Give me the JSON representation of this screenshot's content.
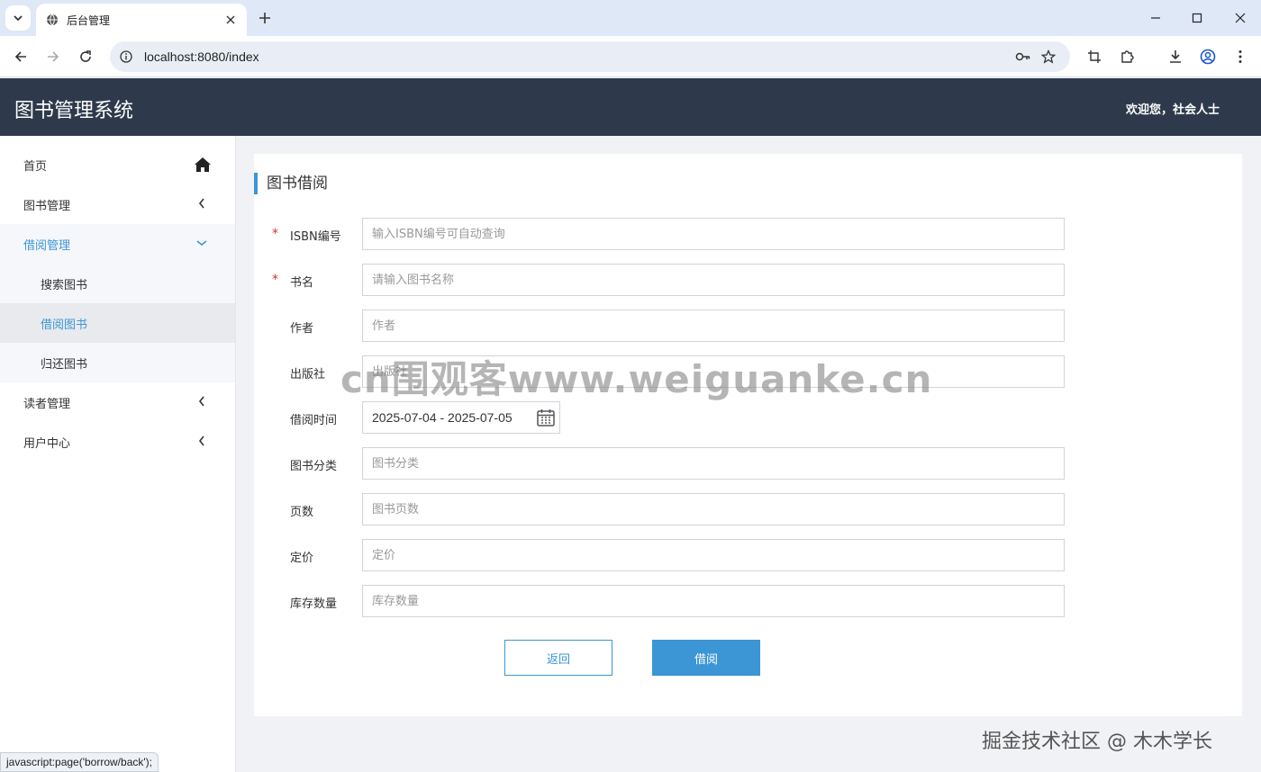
{
  "browser": {
    "tab_title": "后台管理",
    "url": "localhost:8080/index",
    "status_text": "javascript:page('borrow/back');"
  },
  "header": {
    "app_title": "图书管理系统",
    "welcome": "欢迎您，社会人士"
  },
  "sidebar": {
    "items": [
      {
        "label": "首页",
        "icon": "home-icon"
      },
      {
        "label": "图书管理",
        "icon": "chevron-left-icon"
      },
      {
        "label": "借阅管理",
        "icon": "chevron-down-icon",
        "expanded": true
      },
      {
        "label": "读者管理",
        "icon": "chevron-left-icon"
      },
      {
        "label": "用户中心",
        "icon": "chevron-left-icon"
      }
    ],
    "sub_items": [
      {
        "label": "搜索图书"
      },
      {
        "label": "借阅图书",
        "selected": true
      },
      {
        "label": "归还图书"
      }
    ]
  },
  "form": {
    "title": "图书借阅",
    "fields": [
      {
        "label": "ISBN编号",
        "required": true,
        "placeholder": "输入ISBN编号可自动查询",
        "value": ""
      },
      {
        "label": "书名",
        "required": true,
        "placeholder": "请输入图书名称",
        "value": ""
      },
      {
        "label": "作者",
        "required": false,
        "placeholder": "作者",
        "value": ""
      },
      {
        "label": "出版社",
        "required": false,
        "placeholder": "出版社",
        "value": ""
      },
      {
        "label": "借阅时间",
        "required": false,
        "value": "2025-07-04 - 2025-07-05"
      },
      {
        "label": "图书分类",
        "required": false,
        "placeholder": "图书分类",
        "value": ""
      },
      {
        "label": "页数",
        "required": false,
        "placeholder": "图书页数",
        "value": ""
      },
      {
        "label": "定价",
        "required": false,
        "placeholder": "定价",
        "value": ""
      },
      {
        "label": "库存数量",
        "required": false,
        "placeholder": "库存数量",
        "value": ""
      }
    ],
    "back_button": "返回",
    "borrow_button": "借阅"
  },
  "overlay": {
    "watermark": "cn围观客www.weiguanke.cn",
    "credit": "掘金技术社区 @ 木木学长"
  },
  "colors": {
    "header_bg": "#2e3a4c",
    "accent": "#3c95d4",
    "required": "#e02b2b"
  }
}
